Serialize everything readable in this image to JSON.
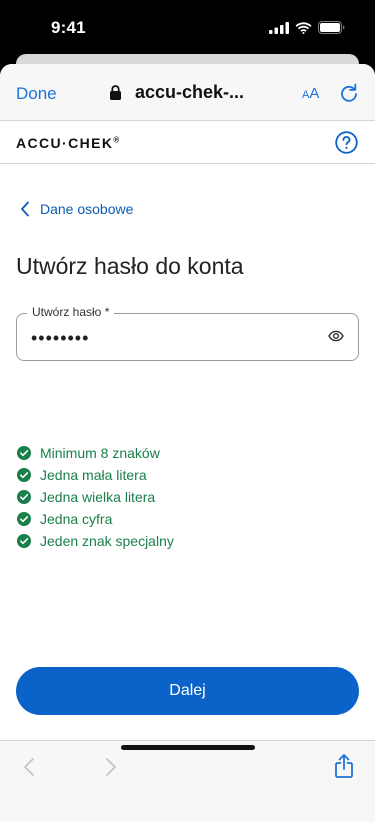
{
  "status_bar": {
    "time": "9:41"
  },
  "browser": {
    "done_label": "Done",
    "url": "accu-chek-...",
    "text_size_small": "A",
    "text_size_large": "A"
  },
  "site": {
    "logo": "ACCU·CHEK",
    "logo_mark": "®"
  },
  "nav": {
    "back_label": "Dane osobowe"
  },
  "heading": "Utwórz hasło do konta",
  "password_field": {
    "label": "Utwórz hasło *",
    "value": "••••••••"
  },
  "requirements": [
    {
      "text": "Minimum 8 znaków",
      "met": true
    },
    {
      "text": "Jedna mała litera",
      "met": true
    },
    {
      "text": "Jedna wielka litera",
      "met": true
    },
    {
      "text": "Jedna cyfra",
      "met": true
    },
    {
      "text": "Jeden znak specjalny",
      "met": true
    }
  ],
  "next_button": "Dalej",
  "colors": {
    "accent": "#1e73d8",
    "primary_button": "#0b63c9",
    "success": "#1a7f4a"
  }
}
